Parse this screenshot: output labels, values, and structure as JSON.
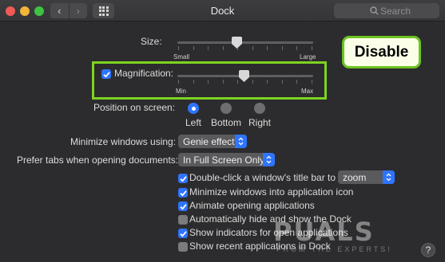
{
  "window": {
    "title": "Dock",
    "search_placeholder": "Search",
    "back_glyph": "‹",
    "forward_glyph": "›"
  },
  "size": {
    "label": "Size:",
    "min_label": "Small",
    "max_label": "Large",
    "value_fraction": 0.5
  },
  "magnification": {
    "label": "Magnification:",
    "checked": true,
    "min_label": "Min",
    "max_label": "Max",
    "value_fraction": 0.5
  },
  "callout": {
    "text": "Disable"
  },
  "position": {
    "label": "Position on screen:",
    "options": [
      {
        "label": "Left",
        "selected": true
      },
      {
        "label": "Bottom",
        "selected": false
      },
      {
        "label": "Right",
        "selected": false
      }
    ]
  },
  "minimize": {
    "label": "Minimize windows using:",
    "value": "Genie effect"
  },
  "tabs": {
    "label": "Prefer tabs when opening documents:",
    "value": "In Full Screen Only"
  },
  "options": [
    {
      "label": "Double-click a window's title bar to",
      "checked": true
    },
    {
      "label": "Minimize windows into application icon",
      "checked": true
    },
    {
      "label": "Animate opening applications",
      "checked": true
    },
    {
      "label": "Automatically hide and show the Dock",
      "checked": false
    },
    {
      "label": "Show indicators for open applications",
      "checked": true
    },
    {
      "label": "Show recent applications in Dock",
      "checked": false
    }
  ],
  "double_click_action": {
    "value": "zoom"
  },
  "watermark": {
    "text": "PUALS",
    "subtext": "FROM THE EXPERTS!"
  },
  "help": {
    "glyph": "?"
  },
  "colors": {
    "accent": "#2f74ff",
    "highlight": "#7ed321",
    "background": "#2c2c2e"
  }
}
